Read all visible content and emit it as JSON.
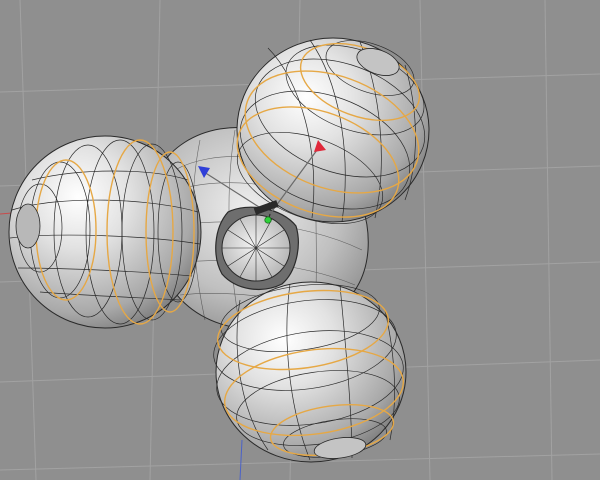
{
  "viewport": {
    "view": "perspective",
    "grid": true,
    "background_color": "#8f8f8f",
    "grid_color": "#a2a2a2",
    "world_axis_color": "#4b62c8"
  },
  "model": {
    "shading": "gouraud-with-wireframe-lines",
    "surface_color": "#d6d6d6",
    "wire_color": "#2a2a2a",
    "selected_edge_color": "#e6a845",
    "spheres": 3,
    "central_hub": 1
  },
  "axis_gizmo": {
    "x_color": "#2ed23a",
    "y_color": "#e0283a",
    "z_color": "#2f3fd8"
  }
}
